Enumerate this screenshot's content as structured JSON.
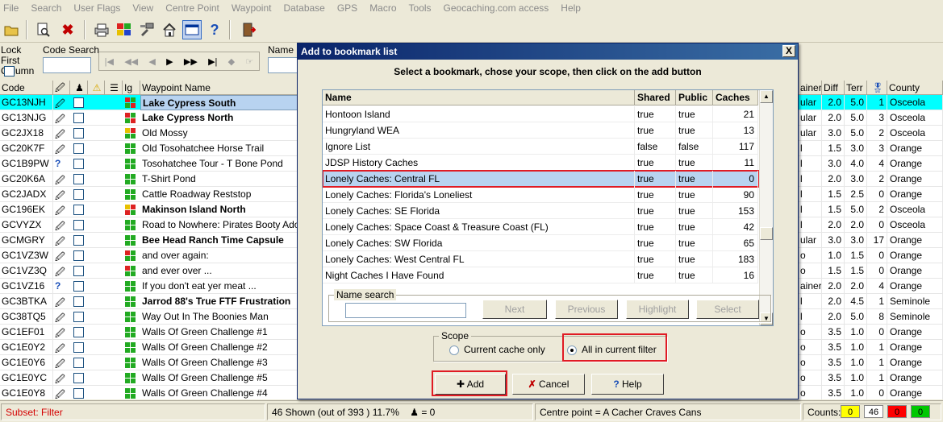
{
  "menu": [
    "File",
    "Search",
    "User Flags",
    "View",
    "Centre Point",
    "Waypoint",
    "Database",
    "GPS",
    "Macro",
    "Tools",
    "Geocaching.com access",
    "Help"
  ],
  "filterbar": {
    "lock_first_column": "Lock First Column",
    "code_search": "Code Search",
    "name_search": "Name S"
  },
  "grid": {
    "headers": {
      "code": "Code",
      "waypoint_name": "Waypoint Name",
      "ig": "Ig",
      "container": "ainer",
      "diff": "Diff",
      "terr": "Terr",
      "county": "County"
    },
    "rows": [
      {
        "code": "GC13NJH",
        "name": "Lake Cypress South",
        "bold": true,
        "container": "ular",
        "diff": "2.0",
        "terr": "5.0",
        "fav": "1",
        "county": "Osceola"
      },
      {
        "code": "GC13NJG",
        "name": "Lake Cypress North",
        "bold": true,
        "container": "ular",
        "diff": "2.0",
        "terr": "5.0",
        "fav": "3",
        "county": "Osceola"
      },
      {
        "code": "GC2JX18",
        "name": "Old Mossy",
        "bold": false,
        "container": "ular",
        "diff": "3.0",
        "terr": "5.0",
        "fav": "2",
        "county": "Osceola"
      },
      {
        "code": "GC20K7F",
        "name": "Old Tosohatchee Horse Trail",
        "bold": false,
        "container": "l",
        "diff": "1.5",
        "terr": "3.0",
        "fav": "3",
        "county": "Orange"
      },
      {
        "code": "GC1B9PW",
        "name": "Tosohatchee Tour - T Bone Pond",
        "bold": false,
        "container": "l",
        "diff": "3.0",
        "terr": "4.0",
        "fav": "4",
        "county": "Orange"
      },
      {
        "code": "GC20K6A",
        "name": "T-Shirt Pond",
        "bold": false,
        "container": "l",
        "diff": "2.0",
        "terr": "3.0",
        "fav": "2",
        "county": "Orange"
      },
      {
        "code": "GC2JADX",
        "name": "Cattle Roadway Reststop",
        "bold": false,
        "container": "l",
        "diff": "1.5",
        "terr": "2.5",
        "fav": "0",
        "county": "Orange"
      },
      {
        "code": "GC196EK",
        "name": "Makinson Island North",
        "bold": true,
        "container": "l",
        "diff": "1.5",
        "terr": "5.0",
        "fav": "2",
        "county": "Osceola"
      },
      {
        "code": "GCVYZX",
        "name": "Road to Nowhere: Pirates Booty Adoption",
        "bold": false,
        "container": "l",
        "diff": "2.0",
        "terr": "2.0",
        "fav": "0",
        "county": "Osceola"
      },
      {
        "code": "GCMGRY",
        "name": "Bee Head Ranch Time Capsule",
        "bold": true,
        "container": "ular",
        "diff": "3.0",
        "terr": "3.0",
        "fav": "17",
        "county": "Orange"
      },
      {
        "code": "GC1VZ3W",
        "name": "and over again:",
        "bold": false,
        "container": "o",
        "diff": "1.0",
        "terr": "1.5",
        "fav": "0",
        "county": "Orange"
      },
      {
        "code": "GC1VZ3Q",
        "name": "and ever over ...",
        "bold": false,
        "container": "o",
        "diff": "1.5",
        "terr": "1.5",
        "fav": "0",
        "county": "Orange"
      },
      {
        "code": "GC1VZ16",
        "name": "If you don't eat yer meat ...",
        "bold": false,
        "container": "ainer",
        "diff": "2.0",
        "terr": "2.0",
        "fav": "4",
        "county": "Orange"
      },
      {
        "code": "GC3BTKA",
        "name": "Jarrod 88's True FTF Frustration",
        "bold": true,
        "container": "l",
        "diff": "2.0",
        "terr": "4.5",
        "fav": "1",
        "county": "Seminole"
      },
      {
        "code": "GC38TQ5",
        "name": "Way Out In The Boonies Man",
        "bold": false,
        "container": "l",
        "diff": "2.0",
        "terr": "5.0",
        "fav": "8",
        "county": "Seminole"
      },
      {
        "code": "GC1EF01",
        "name": "Walls Of Green Challenge #1",
        "bold": false,
        "container": "o",
        "diff": "3.5",
        "terr": "1.0",
        "fav": "0",
        "county": "Orange"
      },
      {
        "code": "GC1E0Y2",
        "name": "Walls Of Green Challenge  #2",
        "bold": false,
        "container": "o",
        "diff": "3.5",
        "terr": "1.0",
        "fav": "1",
        "county": "Orange"
      },
      {
        "code": "GC1E0Y6",
        "name": "Walls Of Green Challenge #3",
        "bold": false,
        "container": "o",
        "diff": "3.5",
        "terr": "1.0",
        "fav": "1",
        "county": "Orange"
      },
      {
        "code": "GC1E0YC",
        "name": "Walls Of Green Challenge #5",
        "bold": false,
        "container": "o",
        "diff": "3.5",
        "terr": "1.0",
        "fav": "1",
        "county": "Orange"
      },
      {
        "code": "GC1E0Y8",
        "name": "Walls Of Green Challenge #4",
        "bold": false,
        "container": "o",
        "diff": "3.5",
        "terr": "1.0",
        "fav": "0",
        "county": "Orange"
      }
    ]
  },
  "status": {
    "subset": "Subset: Filter",
    "shown": "46 Shown (out of 393 )  11.7%",
    "users": "= 0",
    "centre": "Centre point = A Cacher Craves Cans",
    "counts_label": "Counts:",
    "counts": [
      "0",
      "46",
      "0",
      "0"
    ]
  },
  "dialog": {
    "title": "Add to bookmark list",
    "close": "X",
    "instruction": "Select a bookmark, chose your scope, then click on the add button",
    "headers": {
      "name": "Name",
      "shared": "Shared",
      "public": "Public",
      "caches": "Caches"
    },
    "rows": [
      {
        "name": "Hontoon Island",
        "shared": "true",
        "public": "true",
        "caches": "21"
      },
      {
        "name": "Hungryland WEA",
        "shared": "true",
        "public": "true",
        "caches": "13"
      },
      {
        "name": "Ignore List",
        "shared": "false",
        "public": "false",
        "caches": "117"
      },
      {
        "name": "JDSP History Caches",
        "shared": "true",
        "public": "true",
        "caches": "11"
      },
      {
        "name": "Lonely Caches: Central FL",
        "shared": "true",
        "public": "true",
        "caches": "0"
      },
      {
        "name": "Lonely Caches: Florida's Loneliest",
        "shared": "true",
        "public": "true",
        "caches": "90"
      },
      {
        "name": "Lonely Caches: SE Florida",
        "shared": "true",
        "public": "true",
        "caches": "153"
      },
      {
        "name": "Lonely Caches: Space Coast & Treasure Coast (FL)",
        "shared": "true",
        "public": "true",
        "caches": "42"
      },
      {
        "name": "Lonely Caches: SW Florida",
        "shared": "true",
        "public": "true",
        "caches": "65"
      },
      {
        "name": "Lonely Caches: West Central FL",
        "shared": "true",
        "public": "true",
        "caches": "183"
      },
      {
        "name": "Night Caches I Have Found",
        "shared": "true",
        "public": "true",
        "caches": "16"
      }
    ],
    "name_search_label": "Name search",
    "buttons": {
      "next": "Next",
      "previous": "Previous",
      "highlight": "Highlight",
      "select": "Select"
    },
    "scope_label": "Scope",
    "scope_current": "Current cache only",
    "scope_filter": "All in current filter",
    "add": "Add",
    "cancel": "Cancel",
    "help": "Help"
  }
}
